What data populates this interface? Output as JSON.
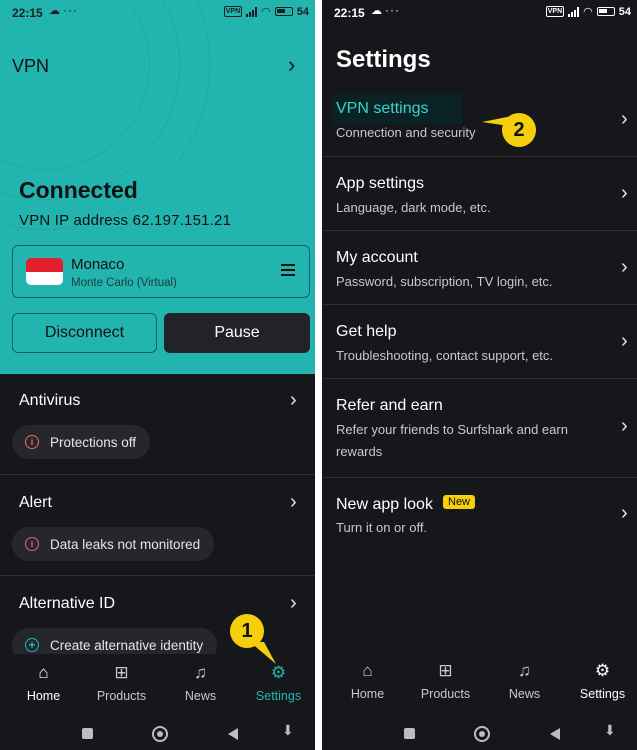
{
  "left": {
    "status": {
      "time": "22:15",
      "battery": "54"
    },
    "header": {
      "vpn_label": "VPN",
      "status": "Connected",
      "ip_line": "VPN IP address 62.197.151.21",
      "location_name": "Monaco",
      "location_sub": "Monte Carlo (Virtual)",
      "disconnect_label": "Disconnect",
      "pause_label": "Pause"
    },
    "sections": [
      {
        "title": "Antivirus",
        "pill": "Protections off"
      },
      {
        "title": "Alert",
        "pill": "Data leaks not monitored"
      },
      {
        "title": "Alternative ID",
        "pill": "Create alternative identity"
      }
    ],
    "nav": [
      "Home",
      "Products",
      "News",
      "Settings"
    ],
    "callout": "1"
  },
  "right": {
    "status": {
      "time": "22:15",
      "battery": "54"
    },
    "title": "Settings",
    "rows": [
      {
        "title": "VPN settings",
        "subtitle": "Connection and security"
      },
      {
        "title": "App settings",
        "subtitle": "Language, dark mode, etc."
      },
      {
        "title": "My account",
        "subtitle": "Password, subscription, TV login, etc."
      },
      {
        "title": "Get help",
        "subtitle": "Troubleshooting, contact support, etc."
      },
      {
        "title": "Refer and earn",
        "subtitle": "Refer your friends to Surfshark and earn rewards"
      },
      {
        "title": "New app look",
        "subtitle": "Turn it on or off.",
        "badge": "New"
      }
    ],
    "nav": [
      "Home",
      "Products",
      "News",
      "Settings"
    ],
    "callout": "2"
  },
  "colors": {
    "teal": "#22b5b0",
    "dark": "#16171b",
    "callout": "#f5cf0b",
    "warning": "#ff5b6b"
  }
}
